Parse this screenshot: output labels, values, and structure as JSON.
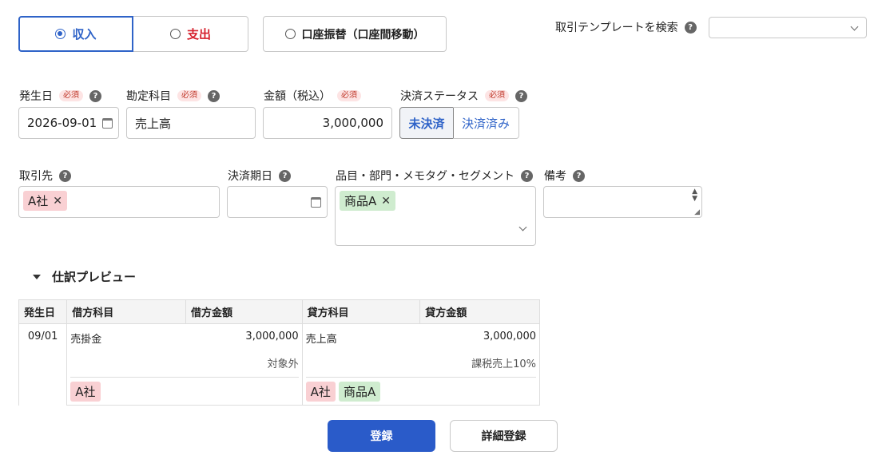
{
  "type_toggle": {
    "income": "収入",
    "expense": "支出",
    "transfer": "口座振替（口座間移動）"
  },
  "template_search": {
    "label": "取引テンプレートを検索",
    "value": ""
  },
  "required_badge": "必須",
  "help_glyph": "?",
  "fields": {
    "issue_date": {
      "label": "発生日",
      "value": "2026-09-01"
    },
    "account": {
      "label": "勘定科目",
      "value": "売上高"
    },
    "amount": {
      "label": "金額（税込）",
      "value": "3,000,000"
    },
    "status": {
      "label": "決済ステータス",
      "options": [
        "未決済",
        "決済済み"
      ],
      "selected": "未決済"
    },
    "partner": {
      "label": "取引先",
      "chip": "A社"
    },
    "due_date": {
      "label": "決済期日",
      "value": ""
    },
    "tags": {
      "label": "品目・部門・メモタグ・セグメント",
      "chip": "商品A"
    },
    "remarks": {
      "label": "備考",
      "value": ""
    }
  },
  "preview": {
    "title": "仕訳プレビュー",
    "headers": [
      "発生日",
      "借方科目",
      "借方金額",
      "貸方科目",
      "貸方金額"
    ],
    "row": {
      "date": "09/01",
      "debit_account": "売掛金",
      "debit_amount": "3,000,000",
      "debit_tax": "対象外",
      "credit_account": "売上高",
      "credit_amount": "3,000,000",
      "credit_tax": "課税売上10%",
      "debit_tags": [
        "A社"
      ],
      "credit_tags": [
        "A社",
        "商品A"
      ]
    }
  },
  "actions": {
    "register": "登録",
    "detail_register": "詳細登録"
  },
  "colors": {
    "accent": "#2f63c8",
    "expense": "#d6222e",
    "partner_chip": "#f9d0d3",
    "item_chip": "#cfeccf"
  }
}
